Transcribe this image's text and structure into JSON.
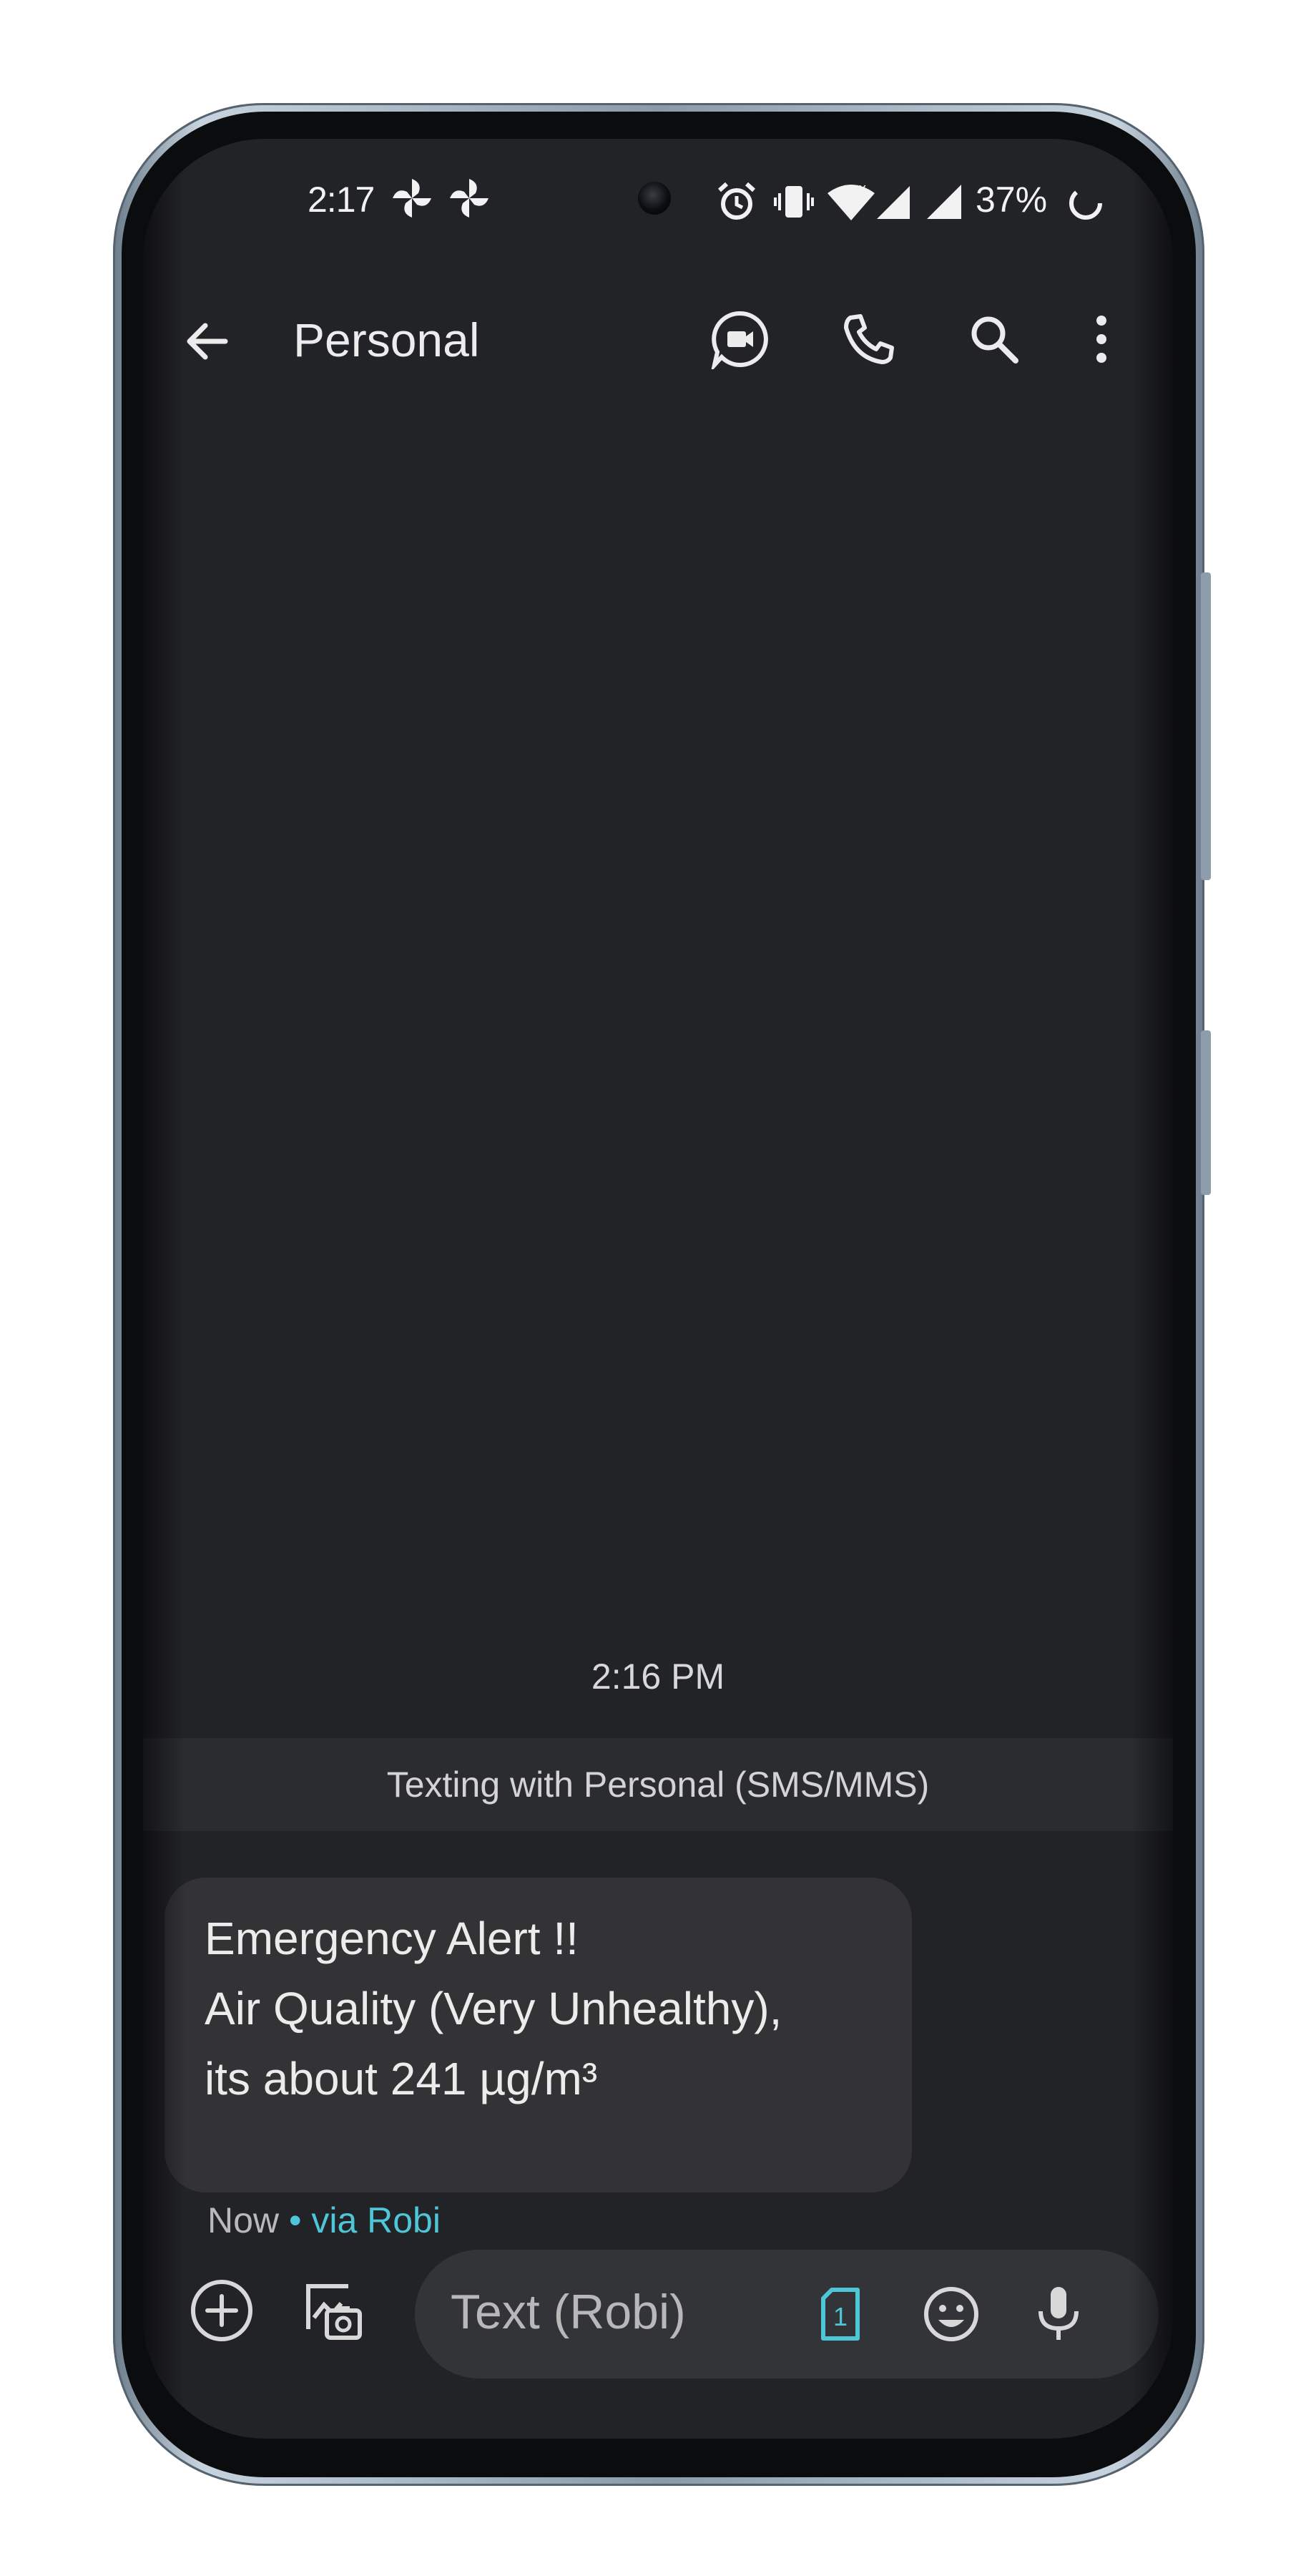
{
  "status_bar": {
    "time": "2:17",
    "battery_percent": "37%"
  },
  "app_bar": {
    "title": "Personal"
  },
  "conversation": {
    "timestamp": "2:16 PM",
    "sms_banner": "Texting with Personal (SMS/MMS)",
    "message": {
      "lines": [
        "Emergency Alert !!",
        "",
        "Air Quality (Very Unhealthy),",
        "its about 241 µg/m³"
      ],
      "time": "Now",
      "via": "• via Robi"
    }
  },
  "compose": {
    "placeholder": "Text (Robi)",
    "sim_number": "1"
  },
  "colors": {
    "background": "#222326",
    "accent": "#4fc6d8",
    "bubble": "#333335"
  },
  "icons": {
    "app_bar": [
      "back-arrow-icon",
      "video-call-icon",
      "phone-icon",
      "search-icon",
      "more-vert-icon"
    ],
    "compose": [
      "add-icon",
      "gallery-icon",
      "sim-card-icon",
      "emoji-icon",
      "mic-icon"
    ]
  }
}
